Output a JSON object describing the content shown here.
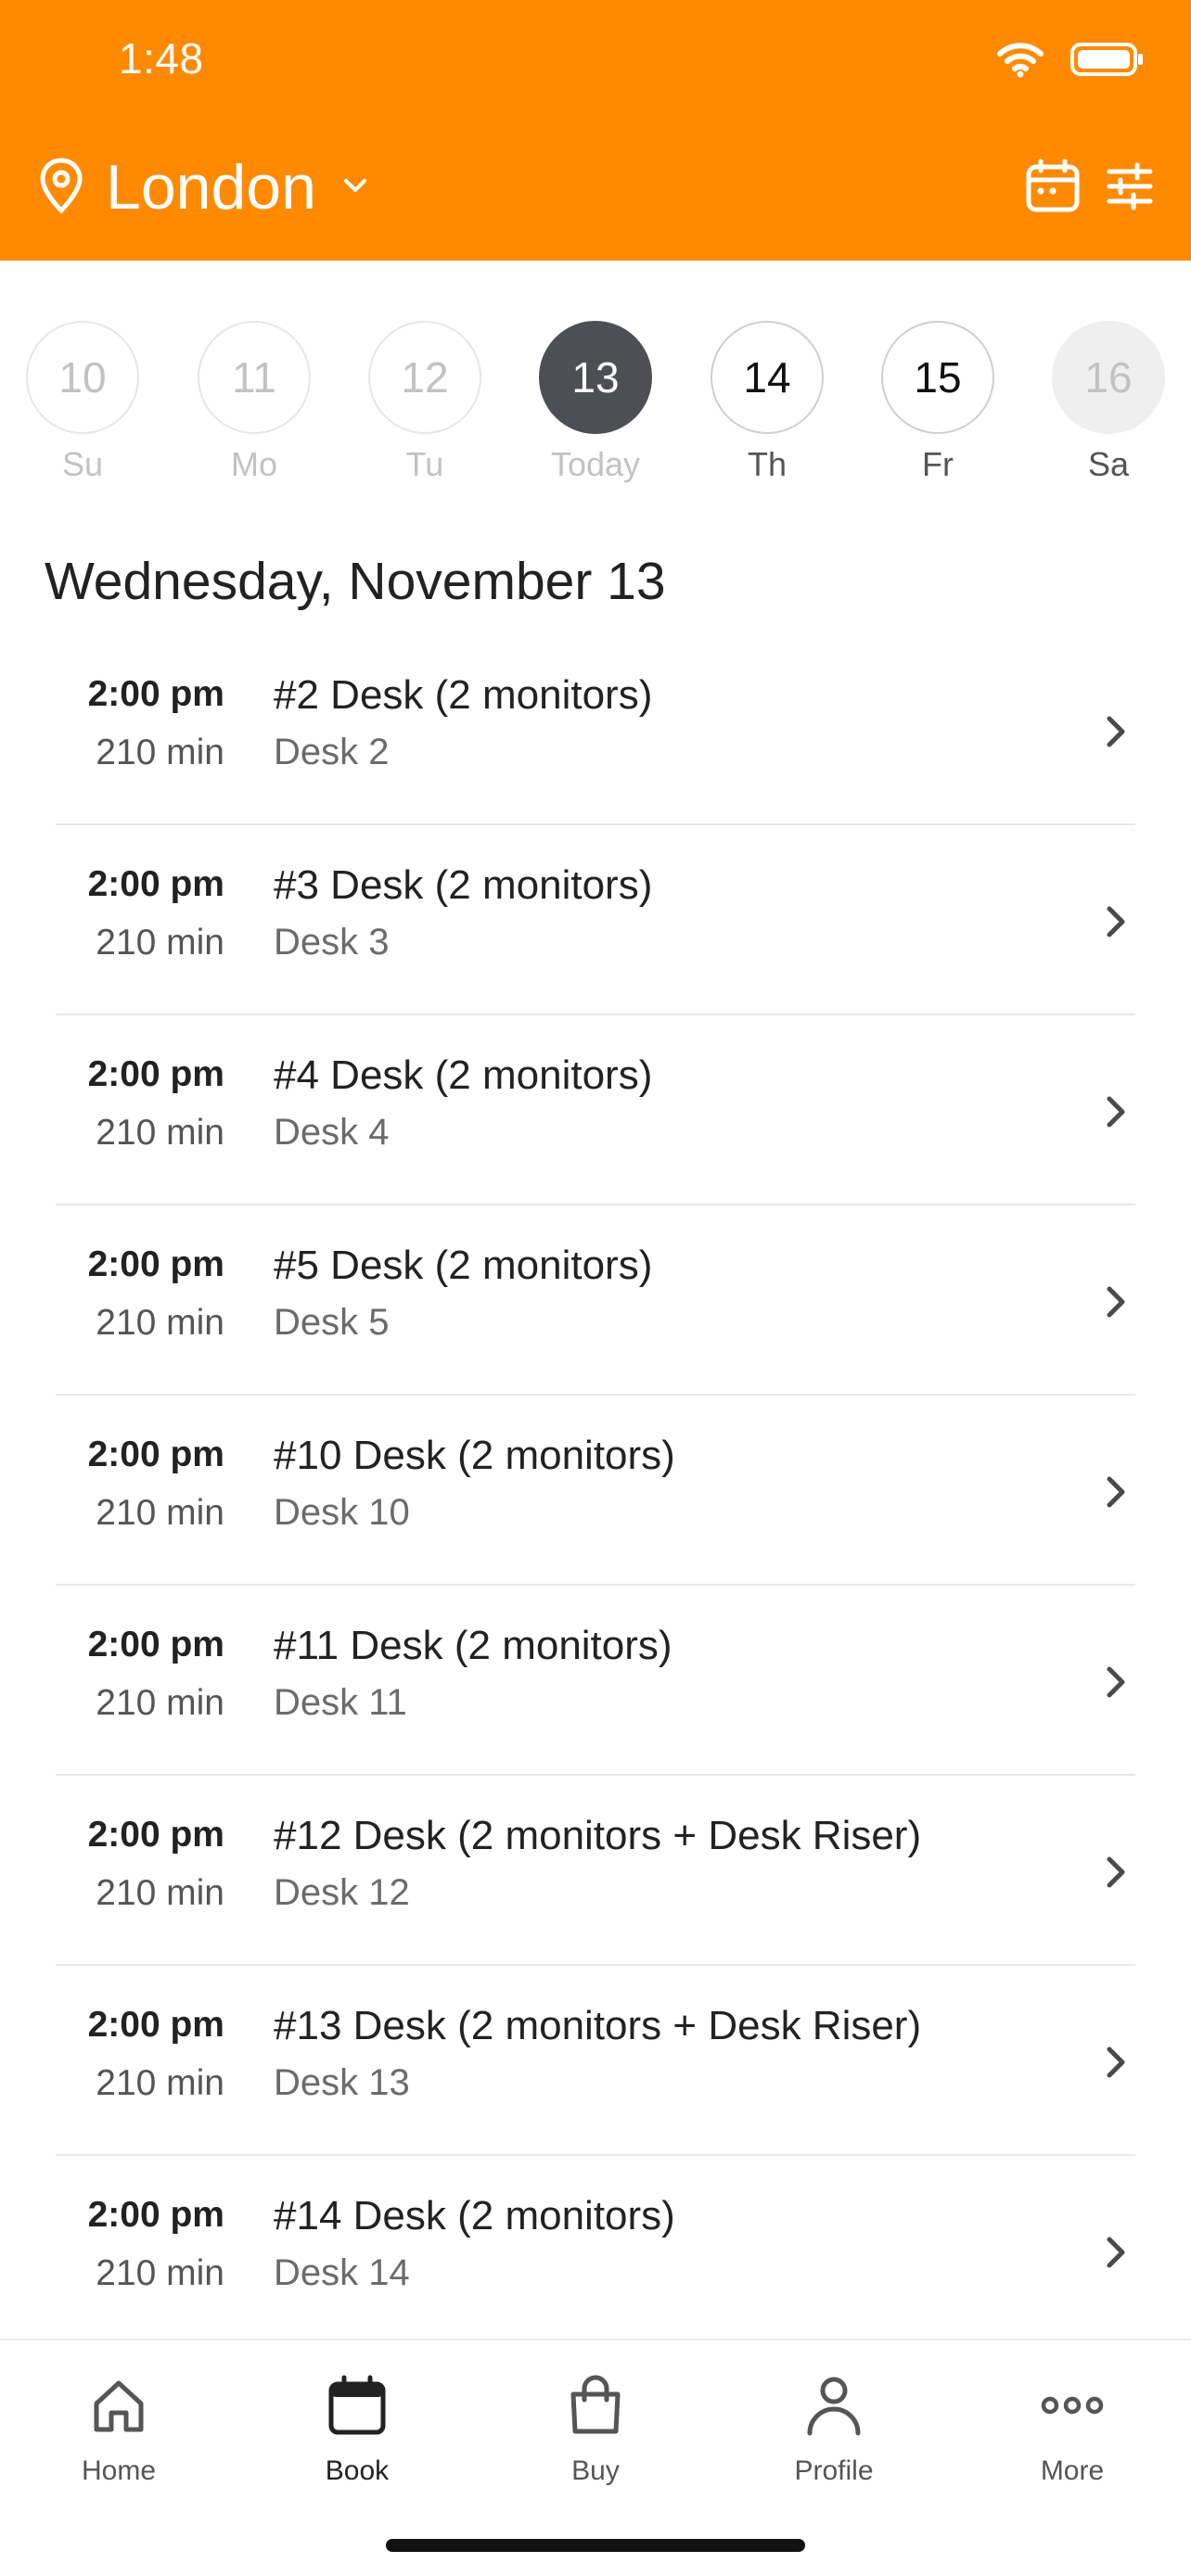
{
  "status_bar": {
    "time": "1:48"
  },
  "header": {
    "location": "London",
    "background": "#FF8A00",
    "icons": [
      "location-pin-icon",
      "chevron-down-icon",
      "calendar-icon",
      "filter-sliders-icon"
    ]
  },
  "dates": [
    {
      "number": "10",
      "label": "Su"
    },
    {
      "number": "11",
      "label": "Mo"
    },
    {
      "number": "12",
      "label": "Tu"
    },
    {
      "number": "13",
      "label": "Today"
    },
    {
      "number": "14",
      "label": "Th"
    },
    {
      "number": "15",
      "label": "Fr"
    },
    {
      "number": "16",
      "label": "Sa"
    }
  ],
  "selected_date": "13",
  "day_heading": "Wednesday, November 13",
  "slots": [
    {
      "time": "2:00 pm",
      "duration": "210 min",
      "title": "#2 Desk (2 monitors)",
      "subtitle": "Desk 2"
    },
    {
      "time": "2:00 pm",
      "duration": "210 min",
      "title": "#3 Desk (2 monitors)",
      "subtitle": "Desk 3"
    },
    {
      "time": "2:00 pm",
      "duration": "210 min",
      "title": "#4 Desk (2 monitors)",
      "subtitle": "Desk 4"
    },
    {
      "time": "2:00 pm",
      "duration": "210 min",
      "title": "#5 Desk (2 monitors)",
      "subtitle": "Desk 5"
    },
    {
      "time": "2:00 pm",
      "duration": "210 min",
      "title": "#10 Desk (2 monitors)",
      "subtitle": "Desk 10"
    },
    {
      "time": "2:00 pm",
      "duration": "210 min",
      "title": "#11 Desk (2 monitors)",
      "subtitle": "Desk 11"
    },
    {
      "time": "2:00 pm",
      "duration": "210 min",
      "title": "#12 Desk (2 monitors + Desk Riser)",
      "subtitle": "Desk 12"
    },
    {
      "time": "2:00 pm",
      "duration": "210 min",
      "title": "#13 Desk (2 monitors + Desk Riser)",
      "subtitle": "Desk 13"
    },
    {
      "time": "2:00 pm",
      "duration": "210 min",
      "title": "#14 Desk (2 monitors)",
      "subtitle": "Desk 14"
    }
  ],
  "tabbar": {
    "items": [
      {
        "label": "Home",
        "icon": "home-icon"
      },
      {
        "label": "Book",
        "icon": "calendar-icon"
      },
      {
        "label": "Buy",
        "icon": "shopping-bag-icon"
      },
      {
        "label": "Profile",
        "icon": "profile-icon"
      },
      {
        "label": "More",
        "icon": "more-dots-icon"
      }
    ],
    "active": "Book"
  }
}
